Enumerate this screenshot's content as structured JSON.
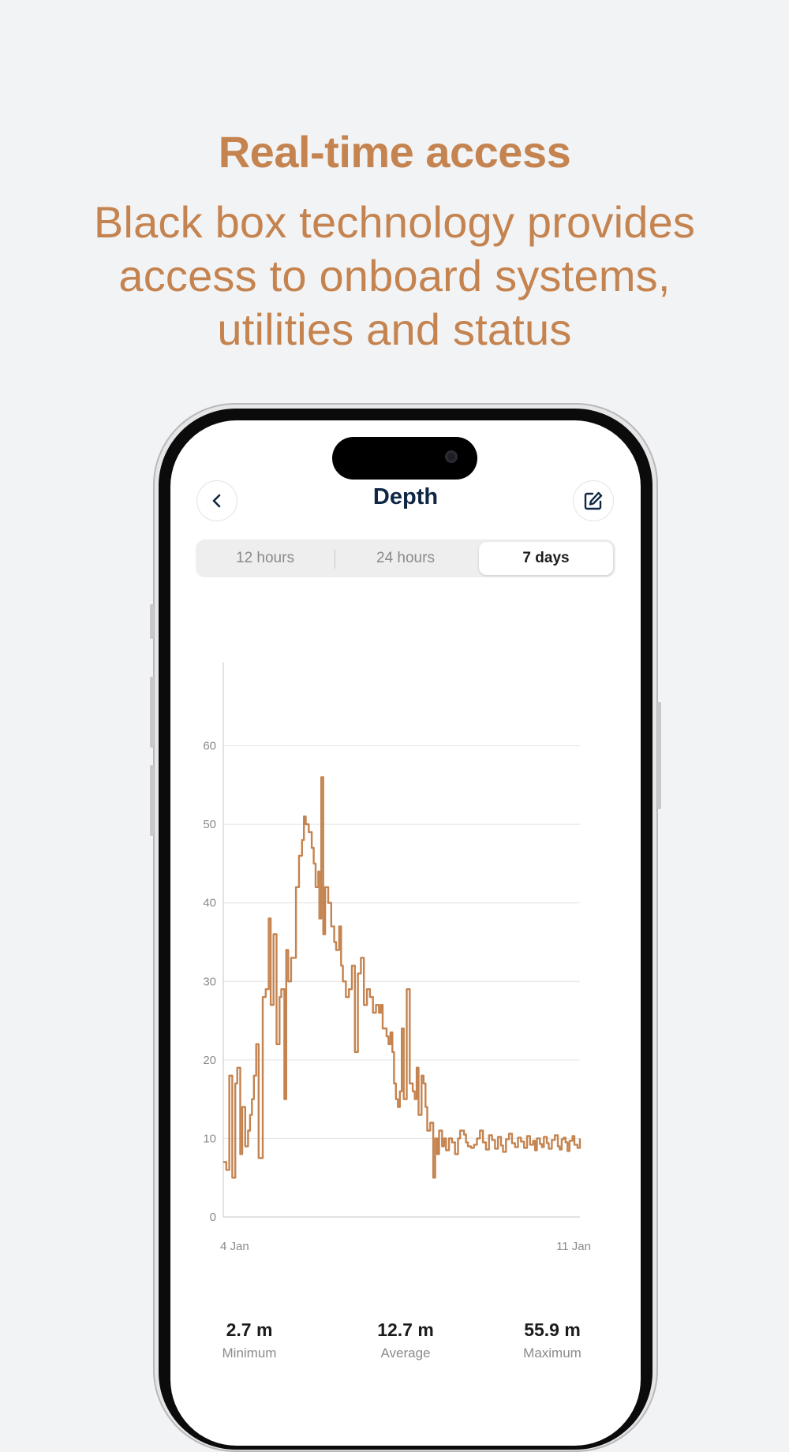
{
  "hero": {
    "headline": "Real-time access",
    "subhead": "Black box technology provides access to onboard systems, utilities and status"
  },
  "app": {
    "title": "Depth",
    "back_icon": "chevron-left-icon",
    "edit_icon": "edit-icon"
  },
  "tabs": [
    {
      "label": "12 hours",
      "active": false
    },
    {
      "label": "24 hours",
      "active": false
    },
    {
      "label": "7 days",
      "active": true
    }
  ],
  "colors": {
    "accent": "#c4834f",
    "title": "#0f2744"
  },
  "chart_data": {
    "type": "line",
    "title": "",
    "xlabel": "",
    "ylabel": "",
    "ylim": [
      0,
      70
    ],
    "yticks": [
      0,
      10,
      20,
      30,
      40,
      50,
      60
    ],
    "xtick_labels": [
      "4 Jan",
      "11 Jan"
    ],
    "xlim": [
      "2024-01-04T00:00",
      "2024-01-11T00:00"
    ],
    "grid": true,
    "step": true,
    "color": "#c4834f",
    "series": [
      {
        "x": [
          "2024-01-04T00:00",
          "2024-01-04T01:25",
          "2024-01-04T02:50",
          "2024-01-04T04:15",
          "2024-01-04T05:40",
          "2024-01-04T06:35",
          "2024-01-04T08:00",
          "2024-01-04T08:55",
          "2024-01-04T10:20",
          "2024-01-04T11:40",
          "2024-01-04T12:35",
          "2024-01-04T13:30",
          "2024-01-04T14:25",
          "2024-01-04T15:30",
          "2024-01-04T16:40",
          "2024-01-04T18:35",
          "2024-01-04T20:00",
          "2024-01-04T21:25",
          "2024-01-04T22:20",
          "2024-01-04T23:40",
          "2024-01-05T01:05",
          "2024-01-05T02:30",
          "2024-01-05T03:20",
          "2024-01-05T04:45",
          "2024-01-05T05:40",
          "2024-01-05T06:35",
          "2024-01-05T07:55",
          "2024-01-05T08:50",
          "2024-01-05T10:15",
          "2024-01-05T11:40",
          "2024-01-05T13:05",
          "2024-01-05T14:00",
          "2024-01-05T14:50",
          "2024-01-05T16:15",
          "2024-01-05T17:40",
          "2024-01-05T18:35",
          "2024-01-05T19:30",
          "2024-01-05T20:45",
          "2024-01-05T21:15",
          "2024-01-05T22:10",
          "2024-01-05T23:05",
          "2024-01-06T00:00",
          "2024-01-06T01:25",
          "2024-01-06T02:50",
          "2024-01-06T04:15",
          "2024-01-06T05:10",
          "2024-01-06T06:35",
          "2024-01-06T07:30",
          "2024-01-06T08:20",
          "2024-01-06T09:45",
          "2024-01-06T11:10",
          "2024-01-06T12:35",
          "2024-01-06T14:00",
          "2024-01-06T15:25",
          "2024-01-06T16:50",
          "2024-01-06T18:15",
          "2024-01-06T19:40",
          "2024-01-06T21:05",
          "2024-01-06T22:30",
          "2024-01-06T23:55",
          "2024-01-07T01:20",
          "2024-01-07T02:15",
          "2024-01-07T03:05",
          "2024-01-07T04:00",
          "2024-01-07T04:55",
          "2024-01-07T05:50",
          "2024-01-07T06:45",
          "2024-01-07T07:40",
          "2024-01-07T08:25",
          "2024-01-07T09:20",
          "2024-01-07T10:15",
          "2024-01-07T11:10",
          "2024-01-07T12:05",
          "2024-01-07T13:00",
          "2024-01-07T14:25",
          "2024-01-07T15:50",
          "2024-01-07T17:15",
          "2024-01-07T18:10",
          "2024-01-07T19:05",
          "2024-01-07T20:00",
          "2024-01-07T21:25",
          "2024-01-07T22:20",
          "2024-01-07T23:15",
          "2024-01-08T00:05",
          "2024-01-08T01:30",
          "2024-01-08T02:55",
          "2024-01-08T03:50",
          "2024-01-08T04:45",
          "2024-01-08T05:40",
          "2024-01-08T07:05",
          "2024-01-08T08:00",
          "2024-01-08T08:55",
          "2024-01-08T10:20",
          "2024-01-08T11:45",
          "2024-01-08T13:10",
          "2024-01-08T14:35",
          "2024-01-08T15:35",
          "2024-01-08T17:25",
          "2024-01-08T18:20",
          "2024-01-08T19:15",
          "2024-01-08T20:40",
          "2024-01-08T22:05",
          "2024-01-08T23:30",
          "2024-01-09T00:55",
          "2024-01-09T02:20",
          "2024-01-09T03:45",
          "2024-01-09T05:10",
          "2024-01-09T06:35",
          "2024-01-09T08:00",
          "2024-01-09T09:25",
          "2024-01-09T10:50",
          "2024-01-09T11:45",
          "2024-01-09T13:10",
          "2024-01-09T14:35",
          "2024-01-09T16:00",
          "2024-01-09T17:25",
          "2024-01-09T18:50",
          "2024-01-09T20:15",
          "2024-01-09T21:40",
          "2024-01-09T23:05",
          "2024-01-10T00:30",
          "2024-01-10T01:55",
          "2024-01-10T02:50",
          "2024-01-10T03:45",
          "2024-01-10T05:10",
          "2024-01-10T06:05",
          "2024-01-10T07:00",
          "2024-01-10T08:25",
          "2024-01-10T09:20",
          "2024-01-10T10:45",
          "2024-01-10T12:10",
          "2024-01-10T13:35",
          "2024-01-10T14:30",
          "2024-01-10T15:25",
          "2024-01-10T16:20",
          "2024-01-10T17:15",
          "2024-01-10T18:10",
          "2024-01-10T19:05",
          "2024-01-10T20:30",
          "2024-01-10T21:25",
          "2024-01-10T22:50",
          "2024-01-11T00:00"
        ],
        "values": [
          7,
          6,
          18,
          5,
          17,
          19,
          8,
          14,
          9,
          11,
          13,
          15,
          18,
          22,
          7.5,
          28,
          29,
          38,
          27,
          36,
          22,
          28,
          29,
          15,
          34,
          30,
          33,
          33,
          42,
          46,
          48,
          51,
          50,
          49,
          47,
          45,
          42,
          44,
          38,
          56,
          36,
          42,
          40,
          37,
          35,
          34,
          37,
          32,
          30,
          28,
          29,
          32,
          21,
          31,
          33,
          27,
          29,
          28,
          26,
          27,
          26,
          27,
          24,
          24,
          23,
          22,
          23.5,
          21,
          17,
          15,
          14,
          16,
          24,
          15,
          29,
          17,
          16,
          15,
          19,
          13,
          18,
          17,
          14,
          11,
          12,
          5,
          10,
          8,
          11,
          9,
          10,
          8.5,
          10,
          9.5,
          8,
          10,
          11,
          10.5,
          9.5,
          9,
          8.8,
          9.2,
          10,
          11,
          9.5,
          8.6,
          10.4,
          9.8,
          8.7,
          10.2,
          9.1,
          8.3,
          9.9,
          10.6,
          9.4,
          8.9,
          10.1,
          9.6,
          8.8,
          10.3,
          9.2,
          9.7,
          8.5,
          10.0,
          9.3,
          8.9,
          10.2,
          9.4,
          8.7,
          9.8,
          10.4,
          9.0,
          8.6,
          9.9,
          10.1,
          9.5,
          8.4,
          9.7,
          10.3,
          9.2,
          8.8,
          10
        ]
      }
    ]
  },
  "stats": [
    {
      "value": "2.7 m",
      "label": "Minimum"
    },
    {
      "value": "12.7 m",
      "label": "Average"
    },
    {
      "value": "55.9 m",
      "label": "Maximum"
    }
  ]
}
